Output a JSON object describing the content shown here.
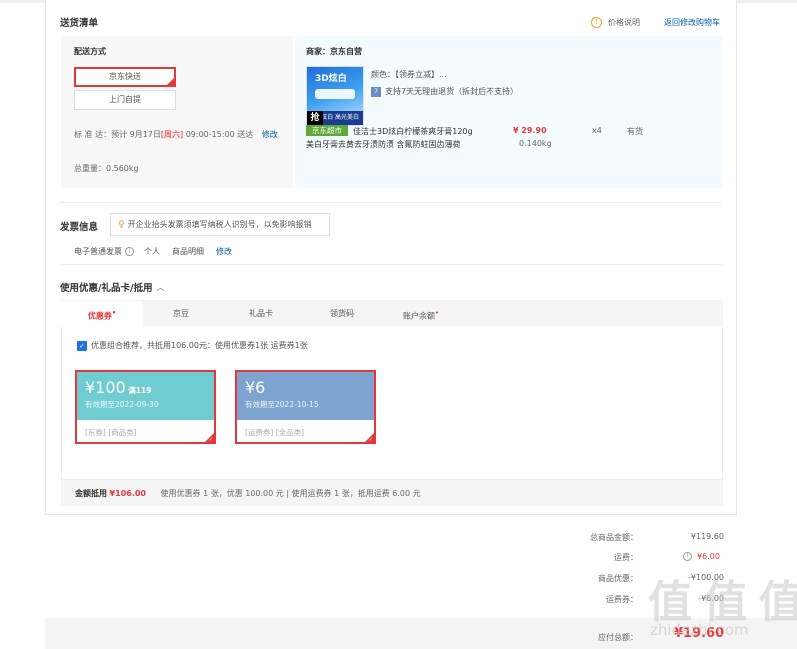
{
  "delivery": {
    "title": "送货清单",
    "price_help": "价格说明",
    "back_to_cart": "返回修改购物车",
    "method_label": "配送方式",
    "methods": [
      "京东快送",
      "上门自提"
    ],
    "eta_prefix": "标 准 达：预计 9月17日",
    "eta_weekday": "[周六]",
    "eta_suffix": " 09:00-15:00 送达",
    "eta_edit": "修改",
    "total_weight": "总重量：0.560kg",
    "merchant": "商家：京东自营",
    "product": {
      "color_label": "颜色：【领券立减】...",
      "return_policy": "支持7天无理由退货（拆封后不支持）",
      "title_line1": "佳洁士3D炫白柠檬茶爽牙膏120g",
      "title_line2": "美白牙膏去黄去牙渍防渍 含氟防蛀固齿薄荷",
      "price": "¥ 29.90",
      "weight": "0.140kg",
      "qty": "x4",
      "stock": "有货",
      "badge": "京东超市",
      "thumb_text": "3D炫白",
      "grab_tag": "抢",
      "thumb_strip": "3D炫白 高光美白"
    }
  },
  "invoice": {
    "title": "发票信息",
    "tip": "开企业抬头发票须填写纳税人识别号，以免影响报销",
    "type": "电子普通发票",
    "info_mark": "i",
    "person": "个人",
    "detail": "商品明细",
    "edit": "修改"
  },
  "discount": {
    "title": "使用优惠/礼品卡/抵用",
    "tabs": [
      "优惠券",
      "京豆",
      "礼品卡",
      "领货码",
      "账户余额"
    ],
    "combo_text": "优惠组合推荐，共抵用106.00元：使用优惠券1张 运费券1张",
    "coupons": [
      {
        "amount": "¥100",
        "cond": "满119",
        "expire": "有效期至2022-09-30",
        "tags": "[东券]  [商品类]",
        "color": "#6fcdd1"
      },
      {
        "amount": "¥6",
        "cond": "",
        "expire": "有效期至2022-10-15",
        "tags": "[运费券]  [全品类]",
        "color": "#7da3d1"
      }
    ],
    "summary_label": "金额抵用",
    "summary_amount": "¥106.00",
    "summary_detail": "使用优惠券 1 张，优惠 100.00 元  |  使用运费券 1 张，抵用运费 6.00 元"
  },
  "totals": {
    "rows": [
      {
        "label": "总商品金额：",
        "value": "¥119.60"
      },
      {
        "label": "运费：",
        "value": "¥6.00"
      },
      {
        "label": "商品优惠：",
        "value": "-¥100.00"
      },
      {
        "label": "运费券：",
        "value": "-¥6.00"
      }
    ],
    "payable_label": "应付总额：",
    "payable_value": "¥19.60"
  },
  "watermark": {
    "text": "值 值 值",
    "url": "zhidezhi.com"
  },
  "colors": {
    "accent": "#e4393c",
    "panel_bg": "#f3fbfe",
    "tab_bg": "#f5f5f5"
  }
}
